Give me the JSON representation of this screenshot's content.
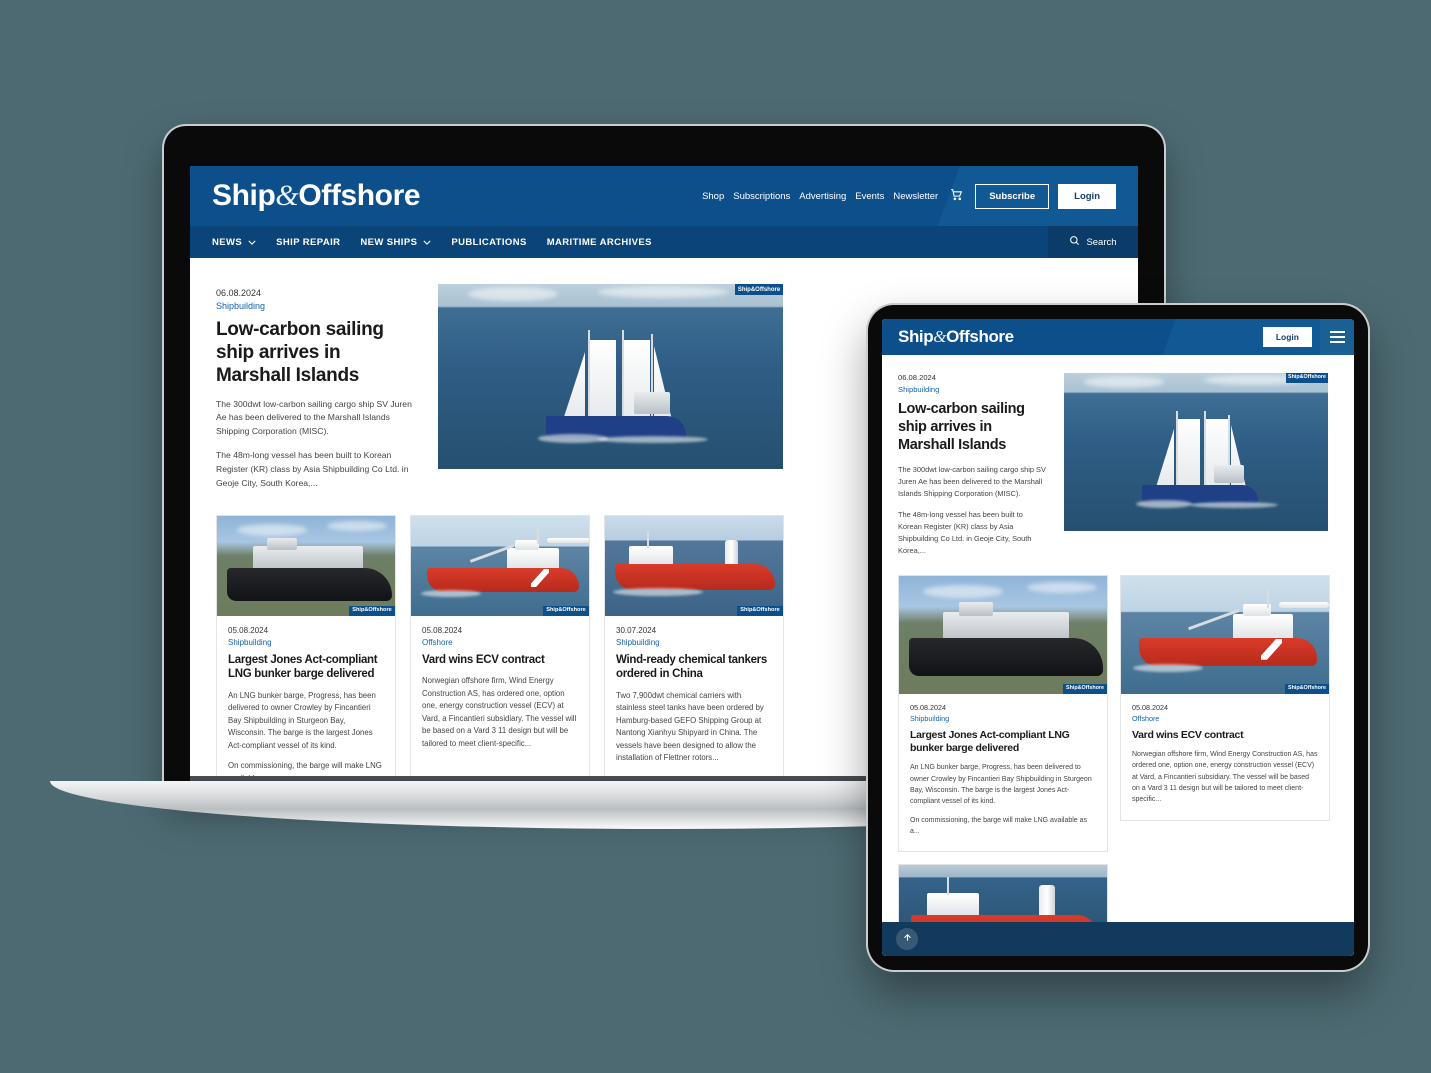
{
  "background_color": "#4d6a72",
  "brand": {
    "name_part1": "Ship",
    "amp": "&",
    "name_part2": "Offshore",
    "primary": "#0d4f8b",
    "nav": "#0b4479",
    "link": "#1063ad"
  },
  "desktop": {
    "utility_links": [
      "Shop",
      "Subscriptions",
      "Advertising",
      "Events",
      "Newsletter"
    ],
    "cart_icon": "cart-icon",
    "subscribe_label": "Subscribe",
    "login_label": "Login",
    "nav_items": [
      {
        "label": "NEWS",
        "caret": true
      },
      {
        "label": "SHIP REPAIR",
        "caret": false
      },
      {
        "label": "NEW SHIPS",
        "caret": true
      },
      {
        "label": "PUBLICATIONS",
        "caret": false
      },
      {
        "label": "MARITIME ARCHIVES",
        "caret": false
      }
    ],
    "search_label": "Search",
    "search_icon": "search-icon",
    "hero": {
      "date": "06.08.2024",
      "category": "Shipbuilding",
      "title": "Low-carbon sailing ship arrives in Marshall Islands",
      "para1": "The 300dwt low-carbon sailing cargo ship SV Juren Ae has been delivered to the Marshall Islands Shipping Corporation (MISC).",
      "para2": "The 48m-long vessel has been built to Korean Register (KR) class by Asia Shipbuilding Co Ltd. in Geoje City, South Korea,...",
      "image_alt": "sailing-cargo-ship-photo",
      "watermark": "Ship&Offshore"
    },
    "cards": [
      {
        "date": "05.08.2024",
        "category": "Shipbuilding",
        "title": "Largest Jones Act-compliant LNG bunker barge delivered",
        "para1": "An LNG bunker barge, Progress, has been delivered to owner Crowley by Fincantieri Bay Shipbuilding in Sturgeon Bay, Wisconsin. The barge is the largest Jones Act-compliant vessel of its kind.",
        "para2": "On commissioning, the barge will make LNG available as a...",
        "image_alt": "lng-bunker-barge-photo",
        "watermark": "Ship&Offshore"
      },
      {
        "date": "05.08.2024",
        "category": "Offshore",
        "title": "Vard wins ECV contract",
        "para1": "Norwegian offshore firm, Wind Energy Construction AS, has ordered one, option one, energy construction vessel (ECV) at Vard, a Fincantieri subsidiary. The vessel will be based on a Vard 3 11 design but will be tailored to meet client-specific...",
        "para2": "",
        "image_alt": "offshore-construction-vessel-render",
        "watermark": "Ship&Offshore"
      },
      {
        "date": "30.07.2024",
        "category": "Shipbuilding",
        "title": "Wind-ready chemical tankers ordered in China",
        "para1": "Two 7,900dwt chemical carriers with stainless steel tanks have been ordered by Hamburg-based GEFO Shipping Group at Nantong Xianhyu Shipyard in China. The vessels have been designed to allow the installation of Flettner rotors...",
        "para2": "",
        "image_alt": "chemical-tanker-render",
        "watermark": "Ship&Offshore"
      }
    ]
  },
  "tablet": {
    "login_label": "Login",
    "menu_icon": "hamburger-menu-icon",
    "scroll_top_icon": "arrow-up-icon",
    "hero": {
      "date": "06.08.2024",
      "category": "Shipbuilding",
      "title": "Low-carbon sailing ship arrives in Marshall Islands",
      "para1": "The 300dwt low-carbon sailing cargo ship SV Juren Ae has been delivered to the Marshall Islands Shipping Corporation (MISC).",
      "para2": "The 48m-long vessel has been built to Korean Register (KR) class by Asia Shipbuilding Co Ltd. in Geoje City, South Korea,...",
      "image_alt": "sailing-cargo-ship-photo",
      "watermark": "Ship&Offshore"
    },
    "cards": [
      {
        "date": "05.08.2024",
        "category": "Shipbuilding",
        "title": "Largest Jones Act-compliant LNG bunker barge delivered",
        "para1": "An LNG bunker barge, Progress, has been delivered to owner Crowley by Fincantieri Bay Shipbuilding in Sturgeon Bay, Wisconsin. The barge is the largest Jones Act-compliant vessel of its kind.",
        "para2": "On commissioning, the barge will make LNG available as a...",
        "image_alt": "lng-bunker-barge-photo",
        "watermark": "Ship&Offshore"
      },
      {
        "date": "05.08.2024",
        "category": "Offshore",
        "title": "Vard wins ECV contract",
        "para1": "Norwegian offshore firm, Wind Energy Construction AS, has ordered one, option one, energy construction vessel (ECV) at Vard, a Fincantieri subsidiary. The vessel will be based on a Vard 3 11 design but will be tailored to meet client-specific...",
        "para2": "",
        "image_alt": "offshore-construction-vessel-render",
        "watermark": "Ship&Offshore"
      },
      {
        "date": "",
        "category": "",
        "title": "",
        "para1": "",
        "para2": "",
        "image_alt": "chemical-tanker-render",
        "watermark": ""
      }
    ]
  }
}
